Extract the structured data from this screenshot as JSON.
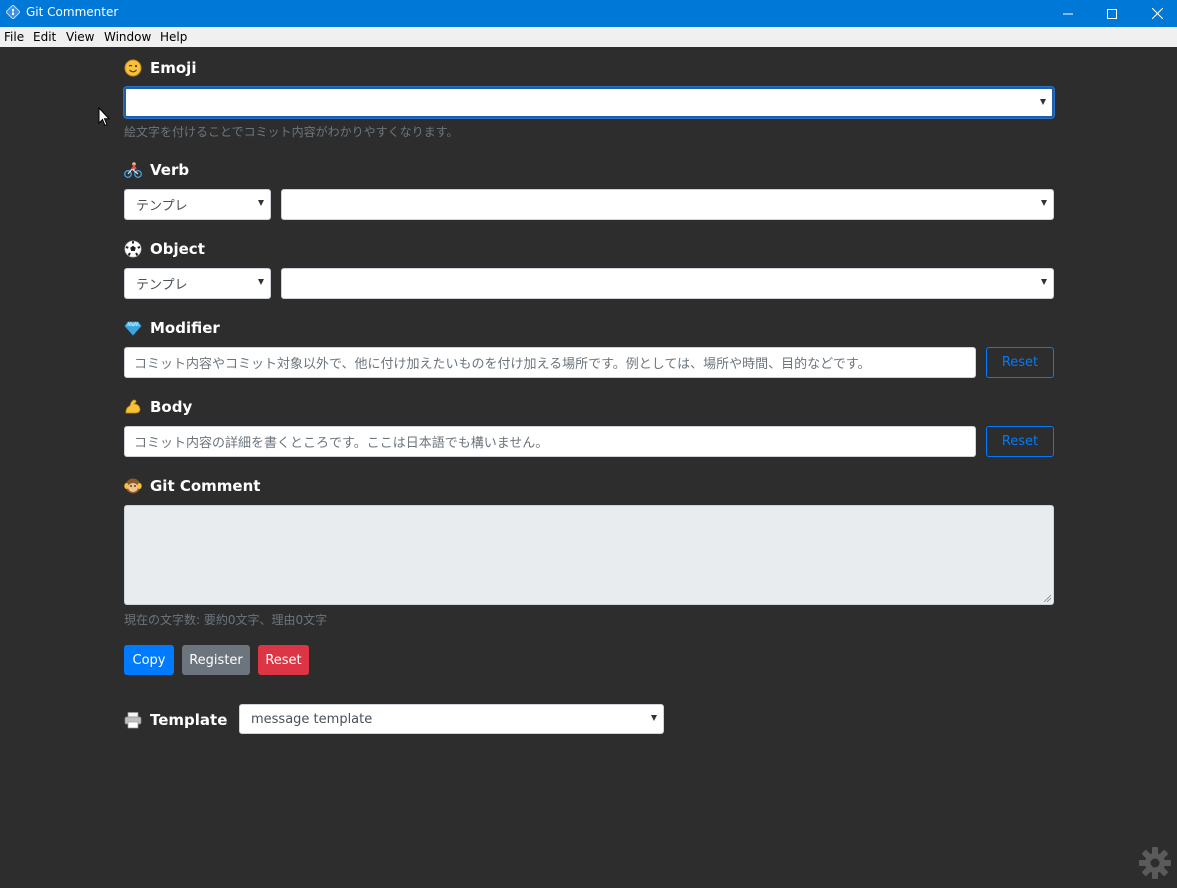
{
  "window": {
    "title": "Git Commenter"
  },
  "menu": [
    "File",
    "Edit",
    "View",
    "Window",
    "Help"
  ],
  "emoji": {
    "label": "Emoji",
    "value": "",
    "hint": "絵文字を付けることでコミット内容がわかりやすくなります。"
  },
  "verb": {
    "label": "Verb",
    "template_value": "テンプレ",
    "value": ""
  },
  "object": {
    "label": "Object",
    "template_value": "テンプレ",
    "value": ""
  },
  "modifier": {
    "label": "Modifier",
    "placeholder": "コミット内容やコミット対象以外で、他に付け加えたいものを付け加える場所です。例としては、場所や時間、目的などです。",
    "reset_label": "Reset"
  },
  "body": {
    "label": "Body",
    "placeholder": "コミット内容の詳細を書くところです。ここは日本語でも構いません。",
    "reset_label": "Reset"
  },
  "git_comment": {
    "label": "Git Comment",
    "value": "",
    "counter": "現在の文字数: 要約0文字、理由0文字"
  },
  "actions": {
    "copy_label": "Copy",
    "register_label": "Register",
    "reset_label": "Reset"
  },
  "template": {
    "label": "Template",
    "value": "message template"
  },
  "colors": {
    "titlebar": "#0078d7",
    "background": "#2d2d2d",
    "primary": "#007bff",
    "secondary": "#6c757d",
    "danger": "#dc3545"
  }
}
